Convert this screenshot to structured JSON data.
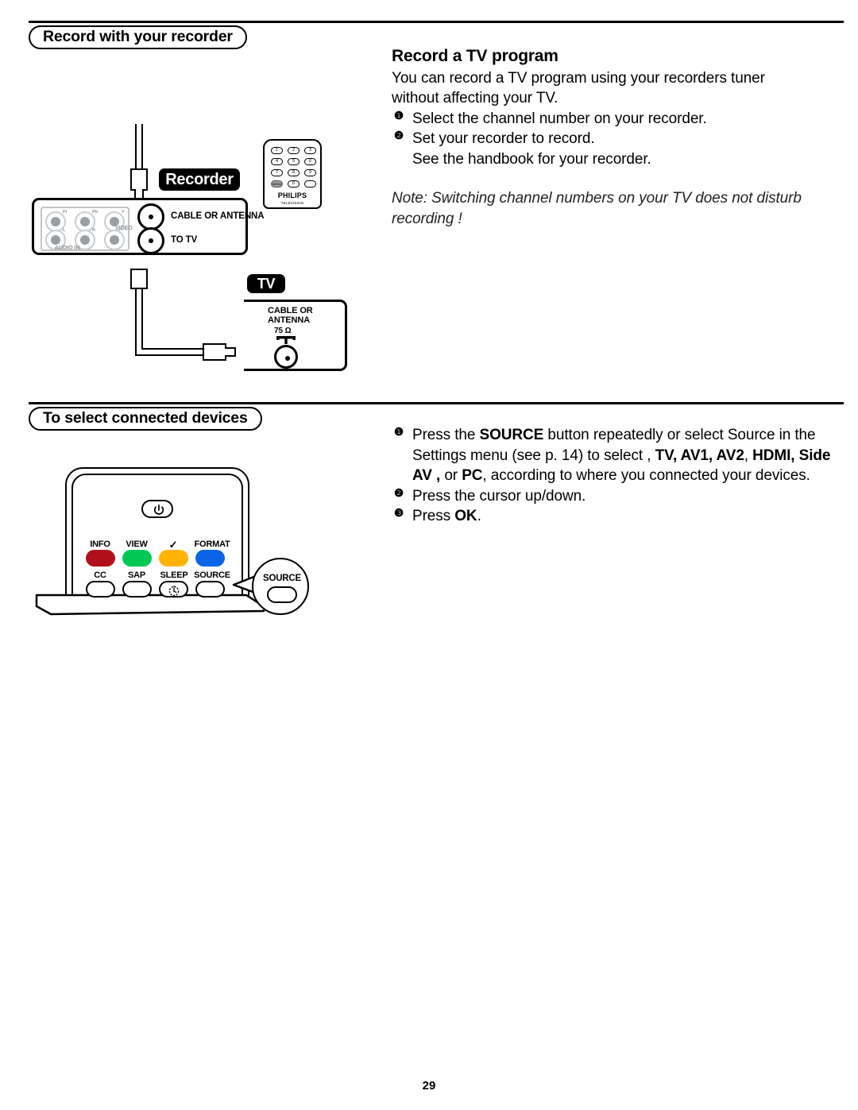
{
  "page": {
    "number": "29"
  },
  "sections": [
    {
      "heading": "Record with your recorder",
      "article": {
        "title": "Record a TV program",
        "intro_line1": "You can record a TV program using your recorders tuner",
        "intro_line2": "without affecting your TV.",
        "steps": [
          {
            "marker": "❶",
            "text": "Select the channel number on your recorder."
          },
          {
            "marker": "❷",
            "text": "Set your recorder to record."
          }
        ],
        "step_continuation": "See the handbook for your recorder.",
        "note_line1": "Note: Switching channel numbers on your TV does not disturb",
        "note_line2": "recording !"
      },
      "figure": {
        "recorder_tag": "Recorder",
        "tv_tag": "TV",
        "recorder_jacks_top": [
          "Pr",
          "Pb",
          "Y"
        ],
        "recorder_jacks_bottom": [
          "L",
          "R",
          "VIDEO"
        ],
        "audio_in_label": "AUDIO IN",
        "recorder_coax_labels": [
          "CABLE OR ANTENNA",
          "TO TV"
        ],
        "tv_coax_label_line1": "CABLE OR",
        "tv_coax_label_line2": "ANTENNA",
        "tv_impedance": "75 Ω",
        "mini_remote": {
          "keys": [
            "1",
            "2",
            "3",
            "4",
            "5",
            "6",
            "7",
            "8",
            "9",
            "MENU",
            "0",
            "·"
          ],
          "brand": "PHILIPS",
          "sub_brand": "TELEVISION"
        }
      }
    },
    {
      "heading": "To select connected devices",
      "steps": [
        {
          "marker": "❶",
          "lines": [
            [
              {
                "t": "Press the ",
                "b": false
              },
              {
                "t": "SOURCE",
                "b": true
              },
              {
                "t": " button repeatedly or select Source in the",
                "b": false
              }
            ],
            [
              {
                "t": "Settings menu (see p. 14) to select , ",
                "b": false
              },
              {
                "t": "TV, AV1, AV2",
                "b": true
              },
              {
                "t": ", ",
                "b": false
              },
              {
                "t": "HDMI, Side",
                "b": true
              }
            ],
            [
              {
                "t": "AV ,",
                "b": true
              },
              {
                "t": " or ",
                "b": false
              },
              {
                "t": "PC",
                "b": true
              },
              {
                "t": ", according to where you connected your devices.",
                "b": false
              }
            ]
          ]
        },
        {
          "marker": "❷",
          "lines": [
            [
              {
                "t": "Press the cursor up/down.",
                "b": false
              }
            ]
          ]
        },
        {
          "marker": "❸",
          "lines": [
            [
              {
                "t": "Press ",
                "b": false
              },
              {
                "t": "OK",
                "b": true
              },
              {
                "t": ".",
                "b": false
              }
            ]
          ]
        }
      ],
      "figure": {
        "power_icon": "power-icon",
        "row_top_captions": [
          "INFO",
          "VIEW",
          "✓",
          "FORMAT"
        ],
        "row_top_colors": [
          "#b0101a",
          "#00c853",
          "#ffb300",
          "#0a64e6"
        ],
        "row_bottom_captions": [
          "CC",
          "SAP",
          "SLEEP",
          "SOURCE"
        ],
        "sleep_icon": "sleep-timer-icon",
        "callout_caption": "SOURCE"
      }
    }
  ]
}
